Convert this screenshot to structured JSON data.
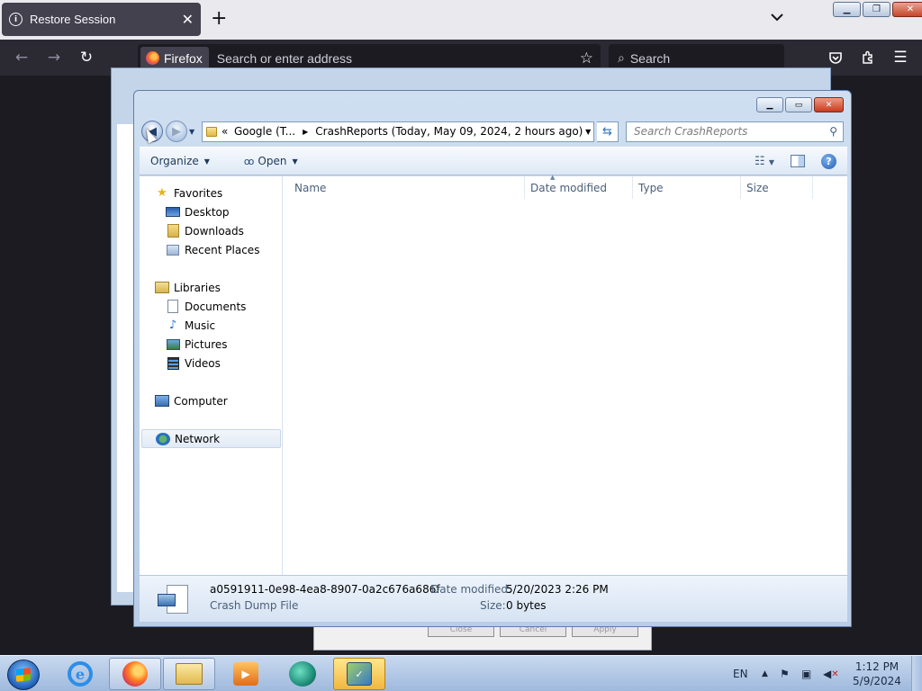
{
  "firefox": {
    "tab_title": "Restore Session",
    "tab_close": "✕",
    "new_tab": "+",
    "badge": "Firefox",
    "url_placeholder": "Search or enter address",
    "search_placeholder": "Search"
  },
  "explorer": {
    "breadcrumb": {
      "overflow": "«",
      "parent": "Google (T...",
      "current": "CrashReports (Today, May 09, 2024, 2 hours ago)"
    },
    "search_placeholder": "Search CrashReports",
    "toolbar": {
      "organize": "Organize",
      "open": "Open"
    },
    "nav": {
      "favorites": "Favorites",
      "desktop": "Desktop",
      "downloads": "Downloads",
      "recent_places": "Recent Places",
      "libraries": "Libraries",
      "documents": "Documents",
      "music": "Music",
      "pictures": "Pictures",
      "videos": "Videos",
      "computer": "Computer",
      "network": "Network"
    },
    "columns": {
      "name": "Name",
      "date_modified": "Date modified",
      "type": "Type",
      "size": "Size"
    },
    "details": {
      "file_name": "a0591911-0e98-4ea8-8907-0a2c676a686f",
      "file_type": "Crash Dump File",
      "date_label": "Date modified:",
      "date_value": "5/20/2023 2:26 PM",
      "size_label": "Size:",
      "size_value": "0 bytes"
    }
  },
  "background_dialog": {
    "close": "Close",
    "cancel": "Cancel",
    "apply": "Apply"
  },
  "taskbar": {
    "language": "EN",
    "time": "1:12 PM",
    "date": "5/9/2024"
  }
}
